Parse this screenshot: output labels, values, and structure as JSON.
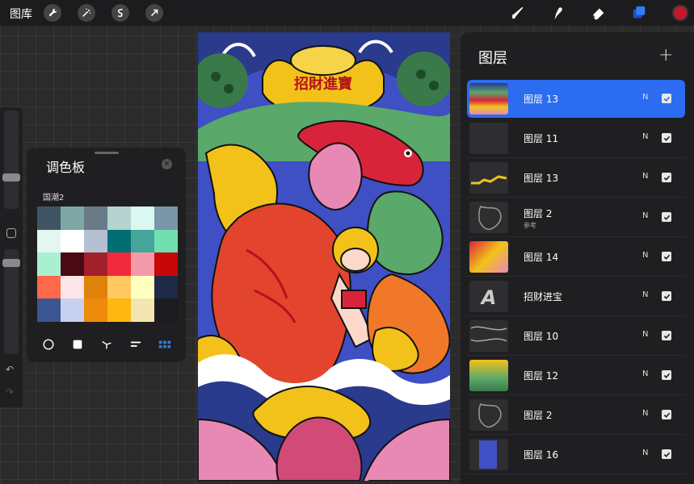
{
  "topbar": {
    "gallery_label": "图库",
    "left_tools": [
      "wrench-icon",
      "magic-wand-icon",
      "selection-icon",
      "transform-arrow-icon"
    ],
    "right_tools": [
      "brush-icon",
      "smudge-icon",
      "eraser-icon",
      "layers-icon"
    ],
    "current_color": "#c6162a"
  },
  "palette": {
    "title": "调色板",
    "palette_name": "国潮2",
    "swatches": [
      "#3f5563",
      "#7fa7a5",
      "#687a86",
      "#b7d3cf",
      "#d8f8f0",
      "#7a96a6",
      "#e2f7f0",
      "#ffffff",
      "#b4c0d2",
      "#006d72",
      "#45a59a",
      "#6fe0b0",
      "#a8f0d0",
      "#4a0a14",
      "#a2202c",
      "#f02a3c",
      "#f59aaa",
      "#c80808",
      "#ff6848",
      "#fde4e8",
      "#e0820a",
      "#ffc860",
      "#ffffc0",
      "#1f2a48",
      "#3b5590",
      "#c8d0f0",
      "#ee8a0c",
      "#ffb810",
      "#f4e6b0",
      "#1c1c1e"
    ],
    "view_modes": [
      "circle",
      "square",
      "scatter",
      "bars",
      "grid"
    ],
    "active_view": "grid"
  },
  "artwork": {
    "banner_text": "招財進寶"
  },
  "layers": {
    "title": "图层",
    "add_label": "+",
    "items": [
      {
        "name": "图层 13",
        "sub": "",
        "blend": "N",
        "visible": true,
        "selected": true,
        "thumb": "art"
      },
      {
        "name": "图层 11",
        "sub": "",
        "blend": "N",
        "visible": true,
        "selected": false,
        "thumb": "dark"
      },
      {
        "name": "图层 13",
        "sub": "",
        "blend": "N",
        "visible": true,
        "selected": false,
        "thumb": "yellow"
      },
      {
        "name": "图层 2",
        "sub": "参考",
        "blend": "N",
        "visible": true,
        "selected": false,
        "thumb": "sketch"
      },
      {
        "name": "图层 14",
        "sub": "",
        "blend": "N",
        "visible": true,
        "selected": false,
        "thumb": "figure"
      },
      {
        "name": "招财进宝",
        "sub": "",
        "blend": "N",
        "visible": true,
        "selected": false,
        "thumb": "text"
      },
      {
        "name": "图层 10",
        "sub": "",
        "blend": "N",
        "visible": true,
        "selected": false,
        "thumb": "lines"
      },
      {
        "name": "图层 12",
        "sub": "",
        "blend": "N",
        "visible": true,
        "selected": false,
        "thumb": "green"
      },
      {
        "name": "图层 2",
        "sub": "",
        "blend": "N",
        "visible": true,
        "selected": false,
        "thumb": "sketch"
      },
      {
        "name": "图层 16",
        "sub": "",
        "blend": "N",
        "visible": true,
        "selected": false,
        "thumb": "blue"
      }
    ]
  }
}
